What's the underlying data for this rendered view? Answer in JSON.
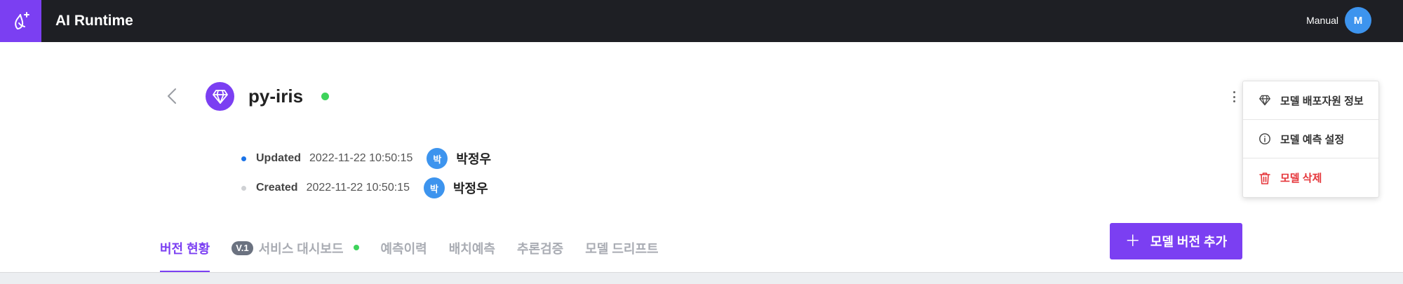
{
  "app": {
    "title": "AI Runtime"
  },
  "user": {
    "name": "Manual",
    "initial": "M"
  },
  "model": {
    "name": "py-iris",
    "status": "running"
  },
  "meta": [
    {
      "label": "Updated",
      "time": "2022-11-22 10:50:15",
      "avatar": "박",
      "user": "박정우",
      "dot_color": "#1a73e8"
    },
    {
      "label": "Created",
      "time": "2022-11-22 10:50:15",
      "avatar": "박",
      "user": "박정우",
      "dot_color": "#cfd1d4"
    }
  ],
  "menu": {
    "items": [
      {
        "label": "모델 배포자원 정보",
        "icon": "diamond-icon"
      },
      {
        "label": "모델 예측 설정",
        "icon": "info-circle-icon"
      },
      {
        "label": "모델 삭제",
        "icon": "trash-icon"
      }
    ]
  },
  "tabs": {
    "items": [
      {
        "label": "버전 현황",
        "active": true
      },
      {
        "label": "서비스 대시보드",
        "badge": "V.1",
        "status_dot": true
      },
      {
        "label": "예측이력"
      },
      {
        "label": "배치예측"
      },
      {
        "label": "추론검증"
      },
      {
        "label": "모델 드리프트"
      }
    ]
  },
  "actions": {
    "add_version": "모델 버전 추가"
  },
  "colors": {
    "accent": "#7b3ff2",
    "topbar": "#1e1f24",
    "status_green": "#3ed35b",
    "avatar_blue": "#3d94ee",
    "danger": "#e5363b"
  }
}
